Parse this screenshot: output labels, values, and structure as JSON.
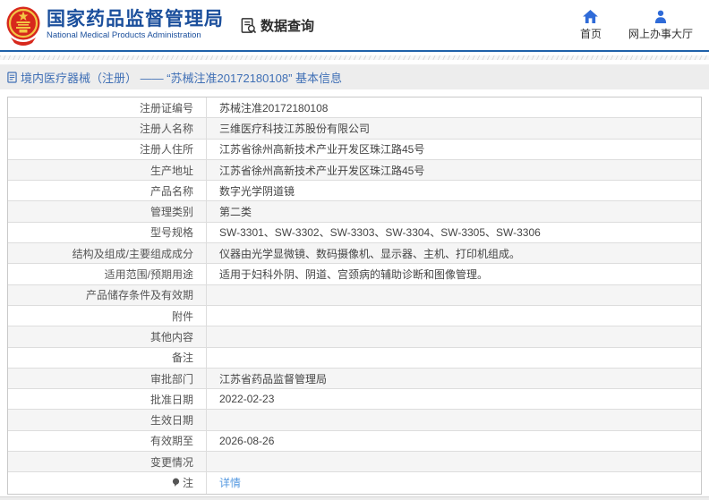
{
  "header": {
    "agency_title": "国家药品监督管理局",
    "agency_subtitle": "National Medical Products Administration",
    "data_query_label": "数据查询",
    "home_label": "首页",
    "service_hall_label": "网上办事大厅"
  },
  "breadcrumb": {
    "text": "境内医疗器械（注册） —— “苏械注准20172180108” 基本信息"
  },
  "detail_table": {
    "rows": [
      {
        "label": "注册证编号",
        "value": "苏械注准20172180108"
      },
      {
        "label": "注册人名称",
        "value": "三维医疗科技江苏股份有限公司"
      },
      {
        "label": "注册人住所",
        "value": "江苏省徐州高新技术产业开发区珠江路45号"
      },
      {
        "label": "生产地址",
        "value": "江苏省徐州高新技术产业开发区珠江路45号"
      },
      {
        "label": "产品名称",
        "value": "数字光学阴道镜"
      },
      {
        "label": "管理类别",
        "value": "第二类"
      },
      {
        "label": "型号规格",
        "value": "SW-3301、SW-3302、SW-3303、SW-3304、SW-3305、SW-3306"
      },
      {
        "label": "结构及组成/主要组成成分",
        "value": "仪器由光学显微镜、数码摄像机、显示器、主机、打印机组成。"
      },
      {
        "label": "适用范围/预期用途",
        "value": "适用于妇科外阴、阴道、宫颈病的辅助诊断和图像管理。"
      },
      {
        "label": "产品储存条件及有效期",
        "value": ""
      },
      {
        "label": "附件",
        "value": ""
      },
      {
        "label": "其他内容",
        "value": ""
      },
      {
        "label": "备注",
        "value": ""
      },
      {
        "label": "审批部门",
        "value": "江苏省药品监督管理局"
      },
      {
        "label": "批准日期",
        "value": "2022-02-23"
      },
      {
        "label": "生效日期",
        "value": ""
      },
      {
        "label": "有效期至",
        "value": "2026-08-26"
      },
      {
        "label": "变更情况",
        "value": ""
      },
      {
        "label": "注",
        "value": "详情",
        "value_is_link": true,
        "label_icon": "note-icon"
      }
    ]
  },
  "colors": {
    "title_blue": "#1b4f9c",
    "icon_blue": "#2f6bd8",
    "link_blue": "#5599e0",
    "breadcrumb_blue": "#3f6fb5",
    "header_rule_blue": "#1f61a9",
    "row_alt_bg": "#f5f5f5",
    "breadcrumb_bg": "#ededed"
  }
}
